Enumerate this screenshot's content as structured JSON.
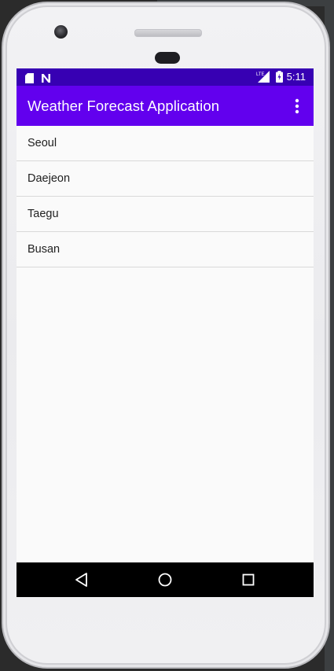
{
  "status_bar": {
    "time": "5:11",
    "left_icons": [
      "sd-card-icon",
      "n-notification-icon"
    ],
    "right_icons": [
      "lte-signal-icon",
      "battery-icon"
    ],
    "lte_label": "LTE",
    "color": "#3700b3"
  },
  "app_bar": {
    "title": "Weather Forecast Application",
    "color": "#6200ee",
    "overflow_icon": "more-vert-icon"
  },
  "city_list": {
    "items": [
      {
        "label": "Seoul"
      },
      {
        "label": "Daejeon"
      },
      {
        "label": "Taegu"
      },
      {
        "label": "Busan"
      }
    ]
  },
  "nav_bar": {
    "buttons": [
      "back-triangle-icon",
      "home-circle-icon",
      "recents-square-icon"
    ]
  }
}
